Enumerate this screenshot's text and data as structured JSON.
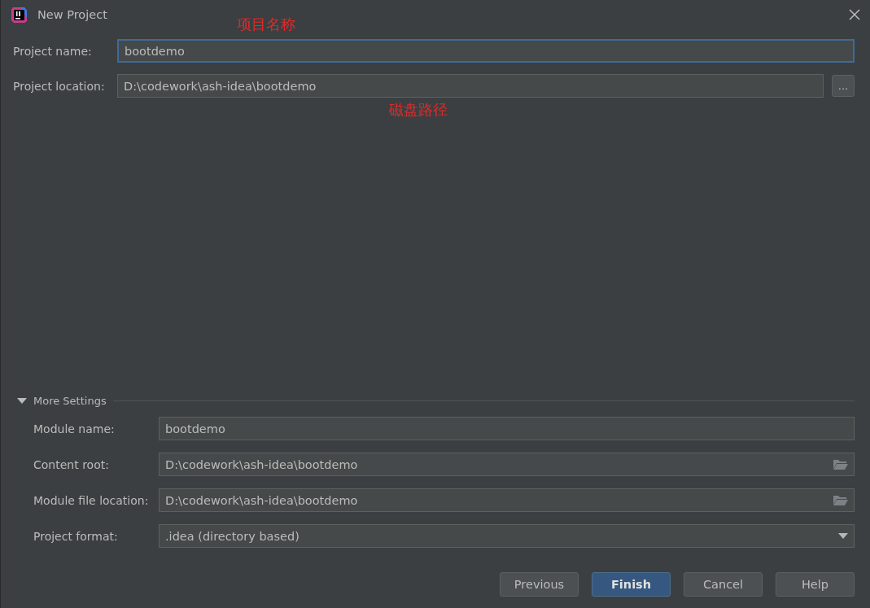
{
  "window": {
    "title": "New Project"
  },
  "fields": [
    {
      "kind": "text",
      "label": "Project name:",
      "value": "bootdemo",
      "focused": true
    },
    {
      "kind": "browse",
      "label": "Project location:",
      "value": "D:\\codework\\ash-idea\\bootdemo",
      "focused": false,
      "button": "..."
    }
  ],
  "annotations": [
    {
      "text": "项目名称",
      "color": "#e02a2a"
    },
    {
      "text": "磁盘路径",
      "color": "#e02a2a"
    }
  ],
  "more_settings": {
    "label": "More Settings",
    "expanded": true,
    "fields": [
      {
        "kind": "text",
        "label": "Module name:",
        "value": "bootdemo"
      },
      {
        "kind": "folder",
        "label": "Content root:",
        "value": "D:\\codework\\ash-idea\\bootdemo"
      },
      {
        "kind": "folder",
        "label": "Module file location:",
        "value": "D:\\codework\\ash-idea\\bootdemo"
      },
      {
        "kind": "dropdown",
        "label": "Project format:",
        "value": ".idea (directory based)"
      }
    ]
  },
  "buttons": [
    {
      "label": "Previous",
      "default": false
    },
    {
      "label": "Finish",
      "default": true
    },
    {
      "label": "Cancel",
      "default": false
    },
    {
      "label": "Help",
      "default": false
    }
  ]
}
